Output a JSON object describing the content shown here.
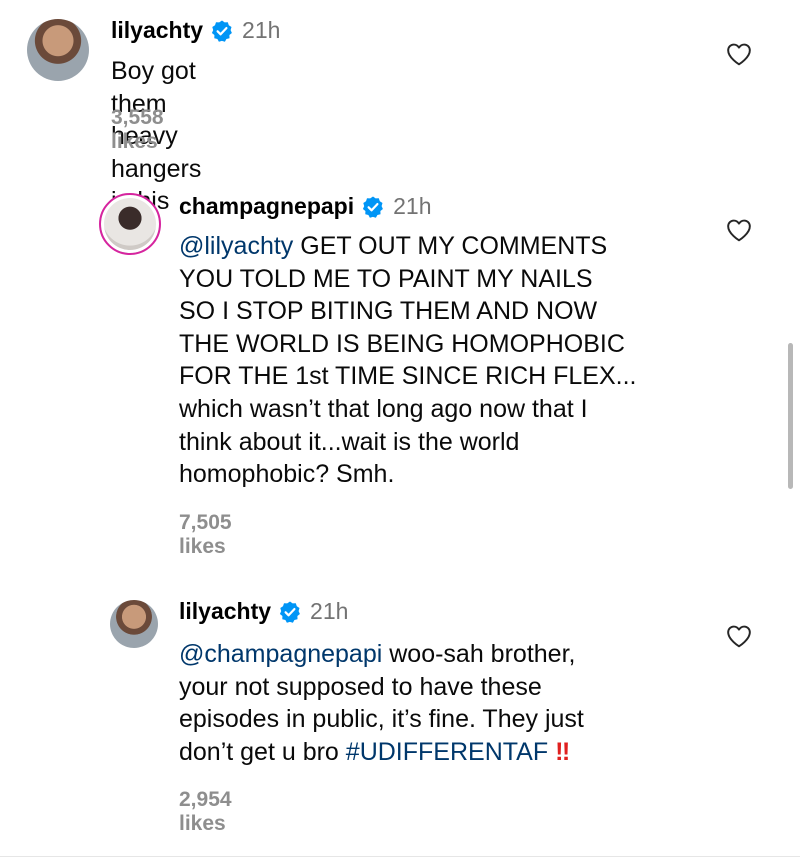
{
  "comments": [
    {
      "username": "lilyachty",
      "time": "21h",
      "text": "Boy got them heavy hangers in his ear",
      "likes": "3,558 likes",
      "avatar_icon": "profile-photo"
    },
    {
      "username": "champagnepapi",
      "time": "21h",
      "mention": "@lilyachty",
      "lines": [
        " GET OUT MY COMMENTS",
        "YOU TOLD ME TO PAINT MY NAILS",
        "SO I STOP BITING THEM AND NOW",
        "THE WORLD IS BEING HOMOPHOBIC",
        "FOR THE 1st TIME SINCE RICH FLEX...",
        "which wasn’t that long ago now that I",
        "think about it...wait is the world",
        "homophobic? Smh."
      ],
      "likes": "7,505 likes",
      "avatar_icon": "profile-photo-with-story-ring"
    },
    {
      "username": "lilyachty",
      "time": "21h",
      "mention": "@champagnepapi",
      "line1_rest": " woo-sah brother,",
      "lines": [
        "your not supposed to have these",
        "episodes in public, it’s fine. They just"
      ],
      "line4_prefix": "don’t get u bro ",
      "hashtag": "#UDIFFERENTAF",
      "emoji": "‼",
      "likes": "2,954 likes",
      "avatar_icon": "profile-photo"
    }
  ],
  "colors": {
    "link": "#00376b",
    "muted": "#737373",
    "verified": "#0095f6",
    "emoji_red": "#e0201f"
  }
}
